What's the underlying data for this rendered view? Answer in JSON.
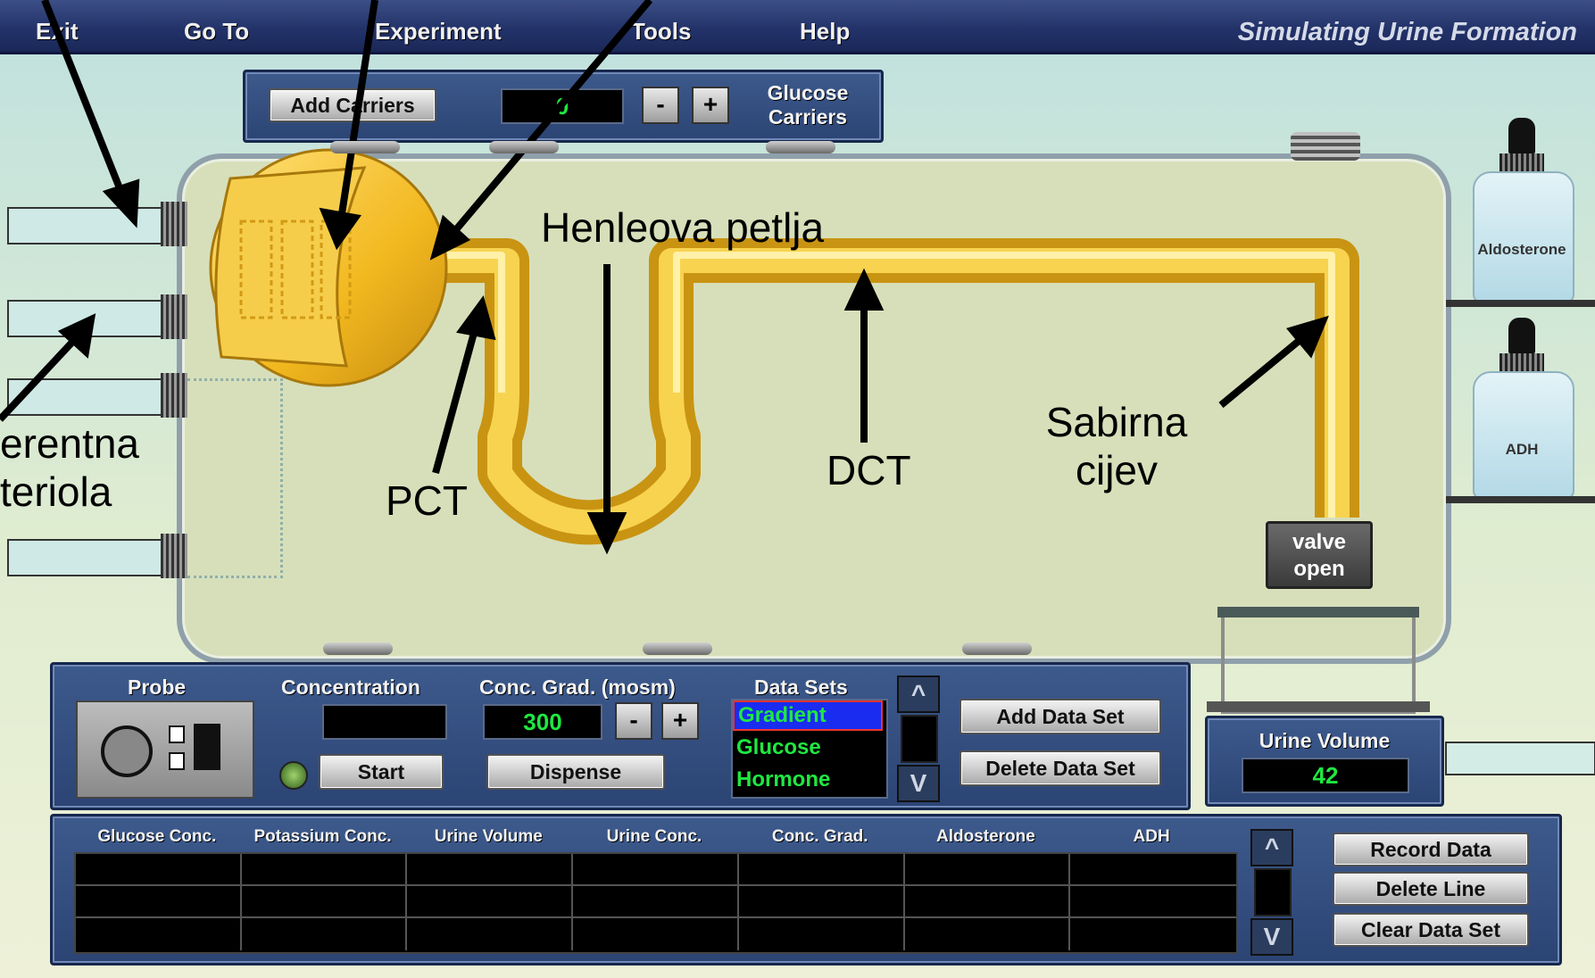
{
  "menu": {
    "exit": "Exit",
    "goto": "Go To",
    "experiment": "Experiment",
    "tools": "Tools",
    "help": "Help"
  },
  "app_title": "Simulating Urine Formation",
  "carriers": {
    "add_label": "Add Carriers",
    "count": "0",
    "minus": "-",
    "plus": "+",
    "label_line1": "Glucose",
    "label_line2": "Carriers"
  },
  "annotations": {
    "henle": "Henleova petlja",
    "pct": "PCT",
    "dct": "DCT",
    "sabirna1": "Sabirna",
    "sabirna2": "cijev",
    "aferent1": "erentna",
    "aferent2": "teriola"
  },
  "bottles": {
    "aldosterone": "Aldosterone",
    "adh": "ADH"
  },
  "valve": {
    "line1": "valve",
    "line2": "open"
  },
  "controls": {
    "probe": "Probe",
    "concentration": "Concentration",
    "conc_value": "",
    "start": "Start",
    "conc_grad": "Conc. Grad. (mosm)",
    "grad_value": "300",
    "minus": "-",
    "plus": "+",
    "dispense": "Dispense",
    "data_sets": "Data Sets",
    "data_set_items": [
      "Gradient",
      "Glucose",
      "Hormone"
    ],
    "add_data_set": "Add Data Set",
    "delete_data_set": "Delete Data Set",
    "up": "^",
    "down": "V"
  },
  "urine": {
    "label": "Urine Volume",
    "value": "42"
  },
  "table": {
    "headers": [
      "Glucose Conc.",
      "Potassium Conc.",
      "Urine Volume",
      "Urine Conc.",
      "Conc. Grad.",
      "Aldosterone",
      "ADH"
    ],
    "rows": 3
  },
  "record": {
    "record_data": "Record Data",
    "delete_line": "Delete Line",
    "clear_data_set": "Clear Data Set"
  },
  "colors": {
    "menu_bg": "#23336a",
    "panel_bg": "#2b4474",
    "display_text": "#1fe840",
    "tubule": "#f2c22e",
    "selected_dataset": "#1a2cf0"
  }
}
